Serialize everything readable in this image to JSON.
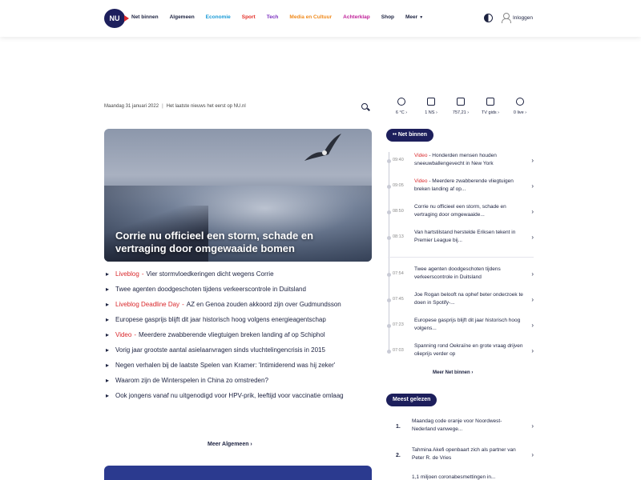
{
  "header": {
    "logo_text": "NU",
    "nav": [
      {
        "label": "Net binnen",
        "color": "#1c2240"
      },
      {
        "label": "Algemeen",
        "color": "#1c2240"
      },
      {
        "label": "Economie",
        "color": "#1a9bd7"
      },
      {
        "label": "Sport",
        "color": "#e4322b"
      },
      {
        "label": "Tech",
        "color": "#7b2fbf"
      },
      {
        "label": "Media en Cultuur",
        "color": "#f08a1c"
      },
      {
        "label": "Achterklap",
        "color": "#c0229a"
      },
      {
        "label": "Shop",
        "color": "#1c2240"
      },
      {
        "label": "Meer",
        "color": "#1c2240"
      }
    ],
    "login_label": "Inloggen",
    "icons": [
      "theme-toggle-icon",
      "user-icon"
    ]
  },
  "dateline": {
    "date": "Maandag 31 januari 2022",
    "tagline": "Het laatste nieuws het eerst op NU.nl"
  },
  "hero": {
    "title": "Corrie nu officieel een storm, schade en vertraging door omgewaaide bomen"
  },
  "headlines": [
    {
      "label": "Liveblog",
      "text": "Vier stormvloedkeringen dicht wegens Corrie"
    },
    {
      "label": "",
      "text": "Twee agenten doodgeschoten tijdens verkeerscontrole in Duitsland"
    },
    {
      "label": "Liveblog Deadline Day",
      "text": "AZ en Genoa zouden akkoord zijn over Gudmundsson"
    },
    {
      "label": "",
      "text": "Europese gasprijs blijft dit jaar historisch hoog volgens energieagentschap"
    },
    {
      "label": "Video",
      "text": "Meerdere zwabberende vliegtuigen breken landing af op Schiphol"
    },
    {
      "label": "",
      "text": "Vorig jaar grootste aantal asielaanvragen sinds vluchtelingencrisis in 2015"
    },
    {
      "label": "",
      "text": "Negen verhalen bij de laatste Spelen van Kramer: 'Intimiderend was hij zeker'"
    },
    {
      "label": "",
      "text": "Waarom zijn de Winterspelen in China zo omstreden?"
    },
    {
      "label": "",
      "text": "Ook jongens vanaf nu uitgenodigd voor HPV-prik, leeftijd voor vaccinatie omlaag"
    }
  ],
  "more_algemeen": "Meer Algemeen ›",
  "widgets": [
    {
      "icon": "weather-icon",
      "value": "6 °C"
    },
    {
      "icon": "traffic-icon",
      "value": "1 NS"
    },
    {
      "icon": "stocks-icon",
      "value": "757,21"
    },
    {
      "icon": "tv-icon",
      "value": "TV gids"
    },
    {
      "icon": "chat-icon",
      "value": "0 live"
    }
  ],
  "net_binnen": {
    "heading": "Net binnen",
    "items": [
      {
        "time": "09:40",
        "label": "Video",
        "text": "Honderden mensen houden sneeuwballengevecht in New York"
      },
      {
        "time": "09:05",
        "label": "Video",
        "text": "Meerdere zwabberende vliegtuigen breken landing af op..."
      },
      {
        "time": "08:50",
        "label": "",
        "text": "Corrie nu officieel een storm, schade en vertraging door omgewaaide..."
      },
      {
        "time": "08:13",
        "label": "",
        "text": "Van hartstilstand herstelde Eriksen tekent in Premier League bij..."
      },
      {
        "time": "07:54",
        "label": "",
        "text": "Twee agenten doodgeschoten tijdens verkeerscontrole in Duitsland"
      },
      {
        "time": "07:45",
        "label": "",
        "text": "Joe Rogan belooft na ophef beter onderzoek te doen in Spotify-..."
      },
      {
        "time": "07:23",
        "label": "",
        "text": "Europese gasprijs blijft dit jaar historisch hoog volgens..."
      },
      {
        "time": "07:03",
        "label": "",
        "text": "Spanning rond Oekraïne en grote vraag drijven olieprijs verder op"
      }
    ],
    "more": "Meer Net binnen ›"
  },
  "meest_gelezen": {
    "heading": "Meest gelezen",
    "items": [
      {
        "num": "1.",
        "text": "Maandag code oranje voor Noordwest-Nederland vanwege..."
      },
      {
        "num": "2.",
        "text": "Tahmina Akefi openbaart zich als partner van Peter R. de Vries"
      },
      {
        "num": "3.",
        "text": "1,1 miljoen coronabesmettingen in..."
      }
    ]
  }
}
